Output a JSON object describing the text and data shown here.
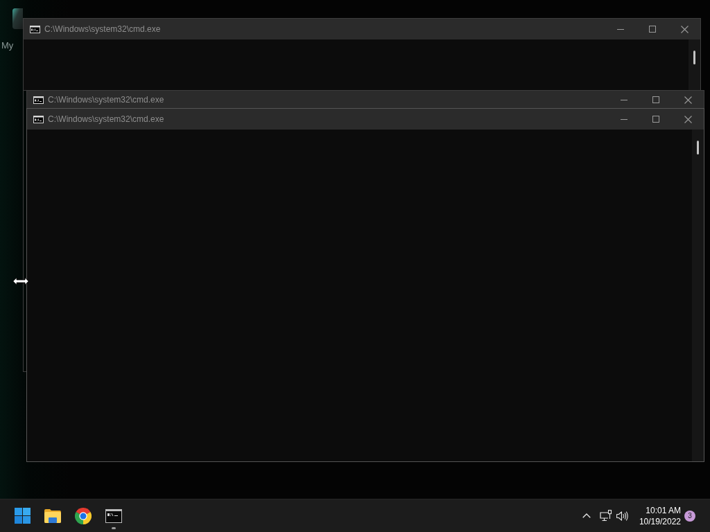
{
  "desktop": {
    "icons": [
      {
        "label": "My"
      }
    ]
  },
  "windows": [
    {
      "title": "C:\\Windows\\system32\\cmd.exe"
    },
    {
      "title": "C:\\Windows\\system32\\cmd.exe"
    },
    {
      "title": "C:\\Windows\\system32\\cmd.exe"
    }
  ],
  "taskbar": {
    "apps": [
      {
        "kind": "explorer",
        "running": false
      },
      {
        "kind": "browser",
        "running": false
      },
      {
        "kind": "terminal",
        "running": true
      }
    ],
    "tray": {
      "time": "10:01 AM",
      "date": "10/19/2022",
      "notifications": "3"
    }
  }
}
